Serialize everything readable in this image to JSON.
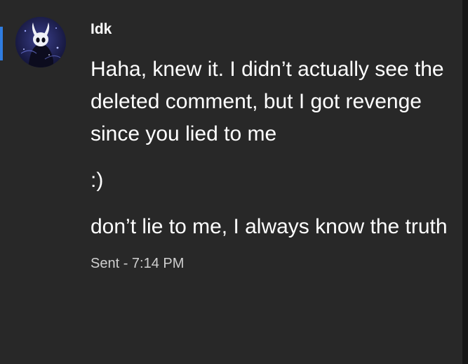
{
  "message": {
    "username": "Idk",
    "paragraphs": [
      "Haha, knew it. I didn’t actually see the deleted comment, but I got revenge since you lied to me",
      ":)",
      "don’t lie to me, I always know the truth"
    ],
    "timestamp": "Sent - 7:14 PM"
  },
  "colors": {
    "background": "#282828",
    "text": "#ffffff",
    "muted_text": "#cfcfcf",
    "indicator": "#2f7de1",
    "avatar_bg": "#1c1e48"
  },
  "icons": {
    "avatar": "hollow-knight-avatar-icon"
  }
}
